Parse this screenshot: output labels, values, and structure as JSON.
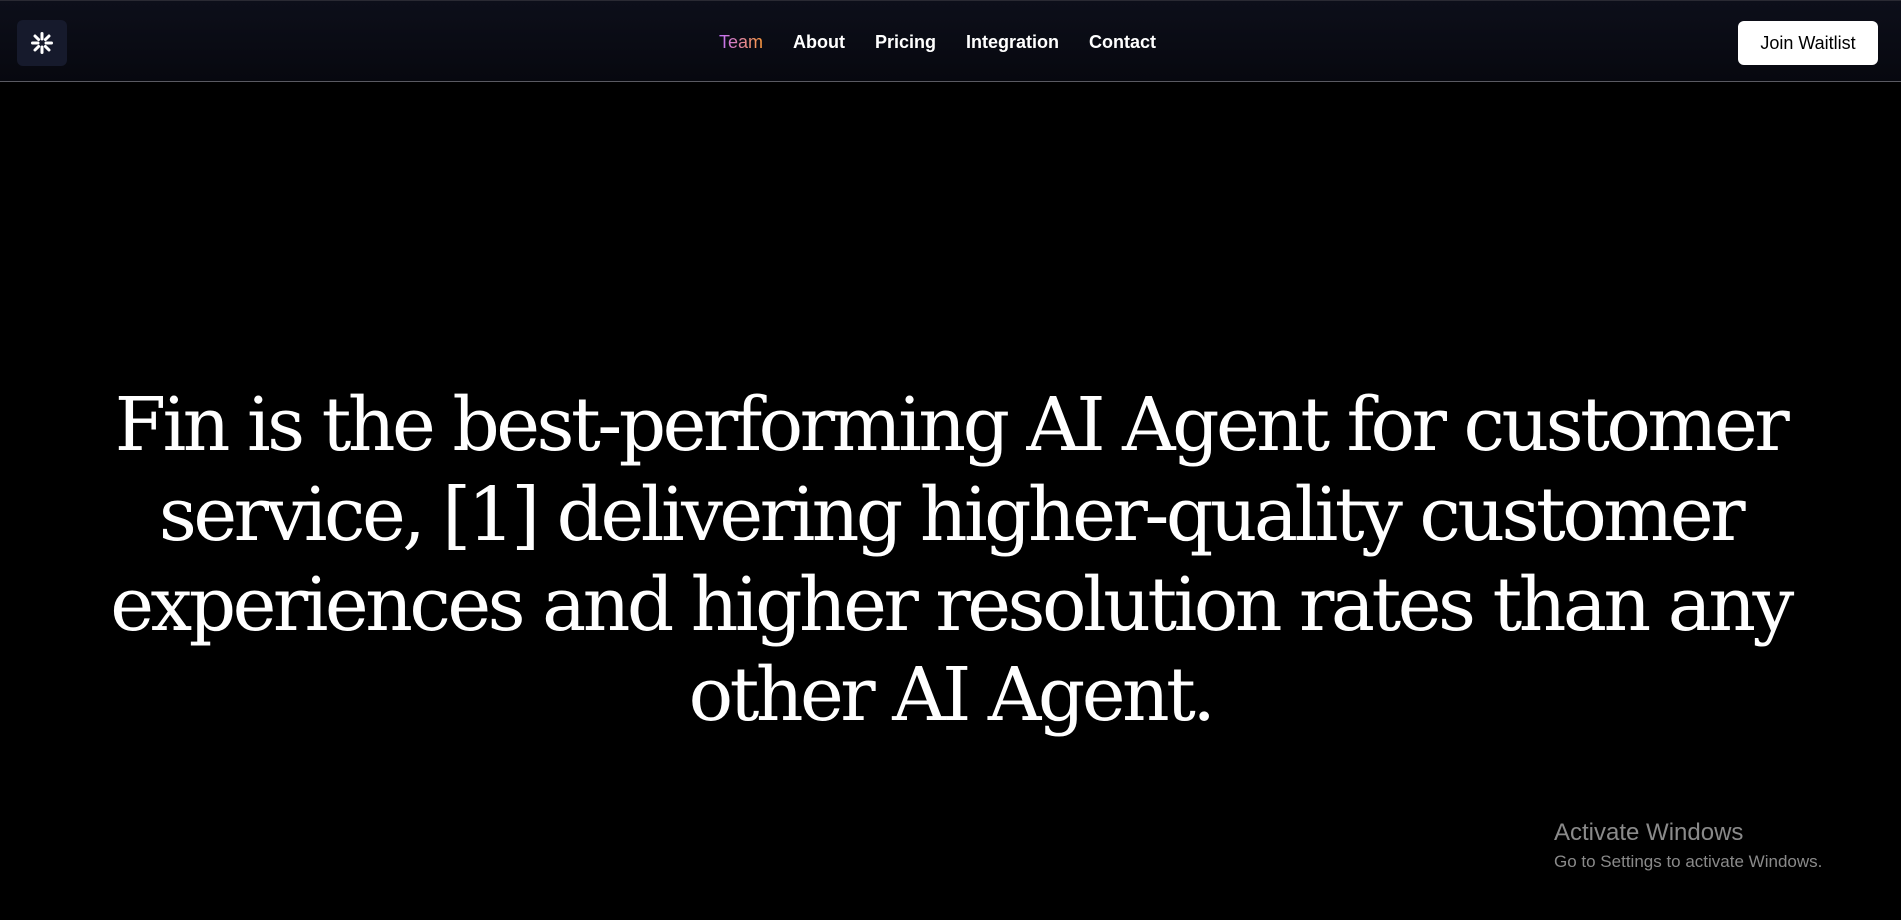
{
  "nav": {
    "logo_icon": "fin-logo-icon",
    "links": [
      {
        "label": "Team",
        "active": true
      },
      {
        "label": "About",
        "active": false
      },
      {
        "label": "Pricing",
        "active": false
      },
      {
        "label": "Integration",
        "active": false
      },
      {
        "label": "Contact",
        "active": false
      }
    ],
    "cta_label": "Join Waitlist"
  },
  "hero": {
    "heading": "Fin is the best-performing AI Agent for customer service, [1] delivering higher-quality customer experiences and higher resolution rates than any other AI Agent."
  },
  "watermark": {
    "title": "Activate Windows",
    "subtitle": "Go to Settings to activate Windows."
  },
  "colors": {
    "background": "#000000",
    "nav_background": "#0d0f1a",
    "active_gradient_start": "#c170ff",
    "active_gradient_end": "#ff9a3c",
    "cta_background": "#ffffff"
  }
}
